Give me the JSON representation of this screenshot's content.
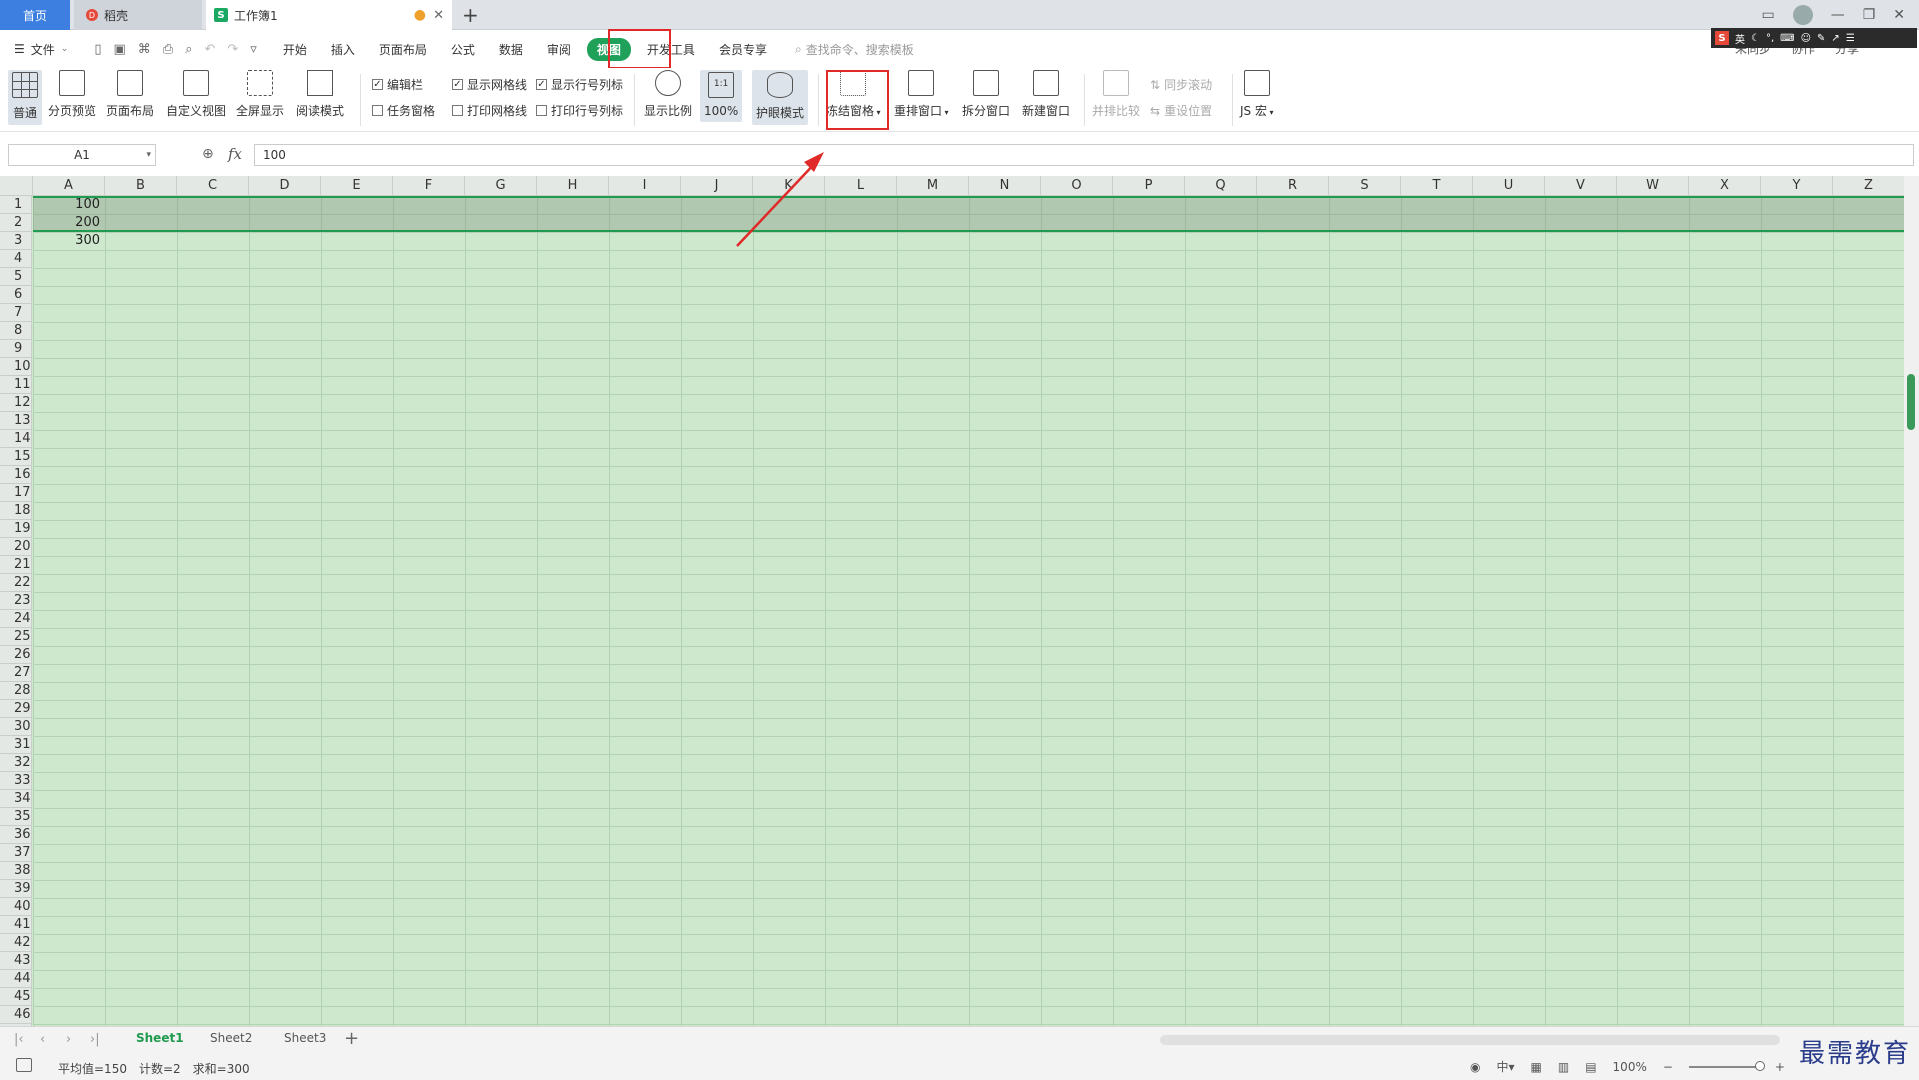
{
  "tabs": {
    "home": "首页",
    "daoke": "稻壳",
    "workbook": "工作簿1"
  },
  "menu": {
    "file": "文件",
    "items": [
      "开始",
      "插入",
      "页面布局",
      "公式",
      "数据",
      "审阅"
    ],
    "view": "视图",
    "items_after": [
      "开发工具",
      "会员专享"
    ],
    "search": "查找命令、搜索模板",
    "right": [
      "未同步",
      "协作",
      "分享"
    ]
  },
  "ribbon": {
    "normal": "普通",
    "page_break_preview": "分页预览",
    "page_layout": "页面布局",
    "custom_view": "自定义视图",
    "full_screen": "全屏显示",
    "reading_mode": "阅读模式",
    "edit_bar": "编辑栏",
    "task_pane": "任务窗格",
    "show_gridlines": "显示网格线",
    "print_gridlines": "打印网格线",
    "show_row_col_headers": "显示行号列标",
    "print_row_col_headers": "打印行号列标",
    "zoom": "显示比例",
    "zoom_100_label": "1:1",
    "zoom_100": "100%",
    "eye_mode": "护眼模式",
    "freeze_panes": "冻结窗格",
    "arrange_windows": "重排窗口",
    "split_window": "拆分窗口",
    "new_window": "新建窗口",
    "side_by_side": "并排比较",
    "sync_scroll": "同步滚动",
    "reset_position": "重设位置",
    "macro": "JS 宏"
  },
  "formula": {
    "name_box": "A1",
    "fx": "fx",
    "value": "100"
  },
  "grid": {
    "columns": [
      "A",
      "B",
      "C",
      "D",
      "E",
      "F",
      "G",
      "H",
      "I",
      "J",
      "K",
      "L",
      "M",
      "N",
      "O",
      "P",
      "Q",
      "R",
      "S",
      "T",
      "U",
      "V",
      "W",
      "X",
      "Y",
      "Z"
    ],
    "row_count": 46,
    "values": [
      "100",
      "200",
      "300"
    ]
  },
  "sheets": [
    "Sheet1",
    "Sheet2",
    "Sheet3"
  ],
  "status": {
    "average": "平均值=150",
    "count": "计数=2",
    "sum": "求和=300",
    "zoom": "100%"
  },
  "watermark": "最需教育",
  "ime": {
    "logo": "S",
    "lang": "英"
  },
  "colors": {
    "accent": "#20a15a",
    "highlight": "#e02a2a",
    "eye_mode_bg": "#cde8cd"
  }
}
